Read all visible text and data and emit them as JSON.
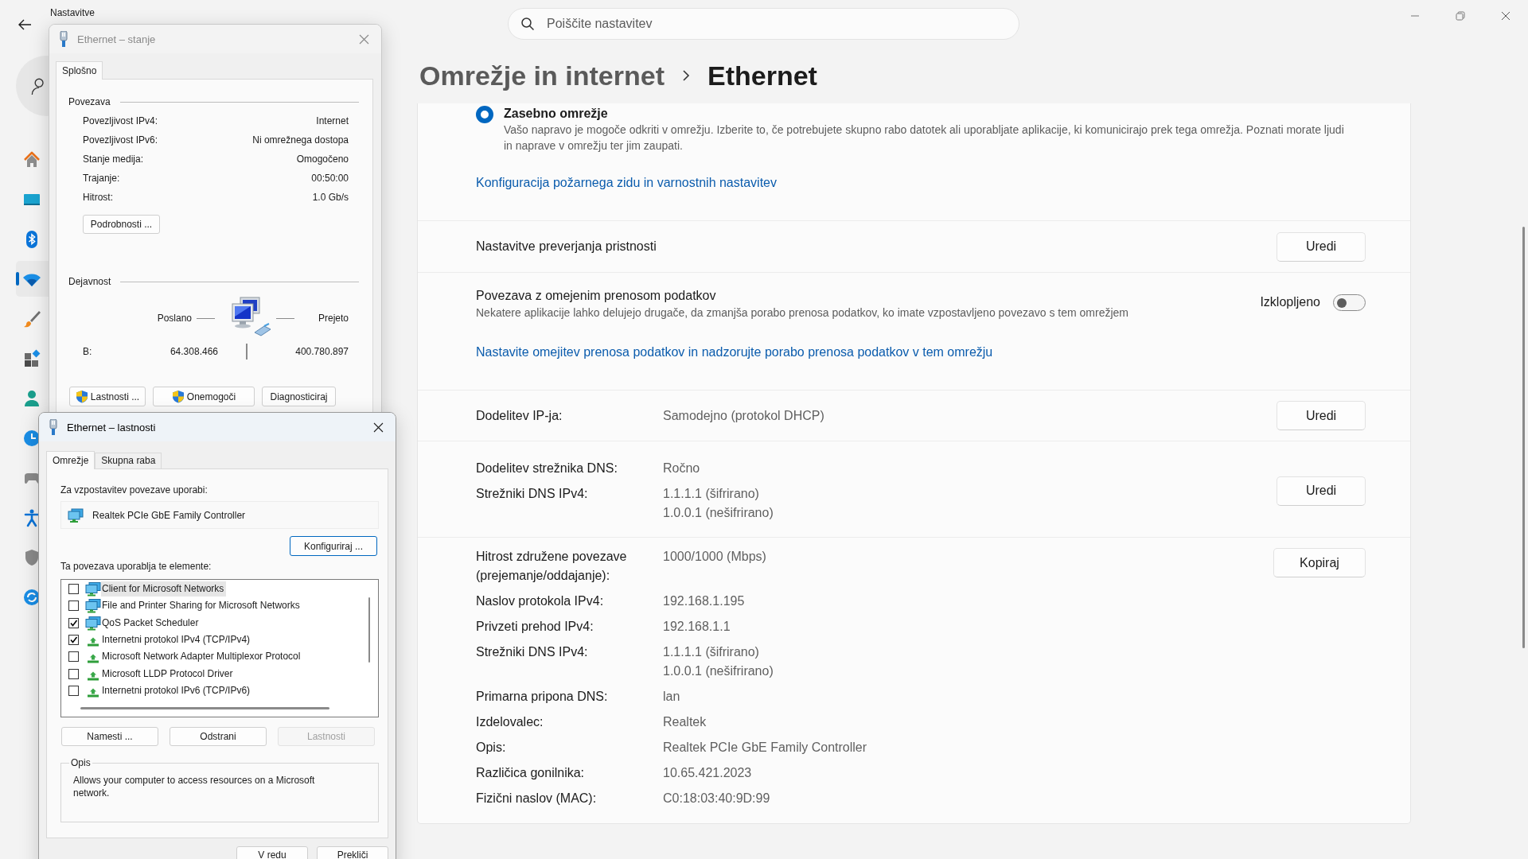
{
  "window": {
    "title": "Nastavitve"
  },
  "search": {
    "placeholder": "Poiščite nastavitev"
  },
  "sidebar": {
    "items": [
      {
        "kind": "home",
        "selected": false
      },
      {
        "kind": "system",
        "selected": false
      },
      {
        "kind": "bluetooth",
        "selected": false
      },
      {
        "kind": "network",
        "selected": true
      },
      {
        "kind": "personalization",
        "selected": false
      },
      {
        "kind": "apps",
        "selected": false
      },
      {
        "kind": "accounts",
        "selected": false
      },
      {
        "kind": "time",
        "selected": false
      },
      {
        "kind": "gaming",
        "selected": false
      },
      {
        "kind": "accessibility",
        "selected": false
      },
      {
        "kind": "privacy",
        "selected": false
      },
      {
        "kind": "update",
        "selected": false
      }
    ]
  },
  "breadcrumb": [
    "Omrežje in internet",
    "Ethernet"
  ],
  "sections": [
    {
      "kind": "profile",
      "option": {
        "label": "Zasebno omrežje",
        "description": "Vašo napravo je mogoče odkriti v omrežju. Izberite to, če potrebujete skupno rabo datotek ali uporabljate aplikacije, ki komunicirajo prek tega omrežja. Poznati morate ljudi in naprave v omrežju ter jim zaupati.",
        "selected": true
      },
      "link": "Konfiguracija požarnega zidu in varnostnih nastavitev"
    },
    {
      "kind": "setting",
      "label": "Nastavitve preverjanja pristnosti",
      "button": "Uredi"
    },
    {
      "kind": "metered",
      "label": "Povezava z omejenim prenosom podatkov",
      "description": "Nekatere aplikacije lahko delujejo drugače, da zmanjša porabo prenosa podatkov, ko imate vzpostavljeno povezavo s tem omrežjem",
      "state_label": "Izklopljeno",
      "on": false,
      "link": "Nastavite omejitev prenosa podatkov in nadzorujte porabo prenosa podatkov v tem omrežju"
    },
    {
      "kind": "properties",
      "rows": [
        {
          "label": "Dodelitev IP-ja:",
          "values": [
            "Samodejno (protokol DHCP)"
          ]
        }
      ],
      "button": "Uredi"
    },
    {
      "kind": "properties",
      "rows": [
        {
          "label": "Dodelitev strežnika DNS:",
          "values": [
            "Ročno"
          ]
        },
        {
          "label": "Strežniki DNS IPv4:",
          "values": [
            "1.1.1.1 (šifrirano)",
            "1.0.0.1 (nešifrirano)"
          ]
        }
      ],
      "button": "Uredi"
    },
    {
      "kind": "properties",
      "rows": [
        {
          "label": "Hitrost združene povezave (prejemanje/oddajanje):",
          "values": [
            "1000/1000 (Mbps)"
          ]
        },
        {
          "label": "Naslov protokola IPv4:",
          "values": [
            "192.168.1.195"
          ]
        },
        {
          "label": "Privzeti prehod IPv4:",
          "values": [
            "192.168.1.1"
          ]
        },
        {
          "label": "Strežniki DNS IPv4:",
          "values": [
            "1.1.1.1 (šifrirano)",
            "1.0.0.1 (nešifrirano)"
          ]
        },
        {
          "label": "Primarna pripona DNS:",
          "values": [
            "lan"
          ]
        },
        {
          "label": "Izdelovalec:",
          "values": [
            "Realtek"
          ]
        },
        {
          "label": "Opis:",
          "values": [
            "Realtek PCIe GbE Family Controller"
          ]
        },
        {
          "label": "Različica gonilnika:",
          "values": [
            "10.65.421.2023"
          ]
        },
        {
          "label": "Fizični naslov (MAC):",
          "values": [
            "C0:18:03:40:9D:99"
          ]
        }
      ],
      "button": "Kopiraj"
    }
  ],
  "status_dialog": {
    "title": "Ethernet – stanje",
    "active": false,
    "tabs": [
      {
        "label": "Splošno",
        "selected": true
      }
    ],
    "connection": {
      "heading": "Povezava",
      "rows": [
        {
          "label": "Povezljivost IPv4:",
          "value": "Internet"
        },
        {
          "label": "Povezljivost IPv6:",
          "value": "Ni omrežnega dostopa"
        },
        {
          "label": "Stanje medija:",
          "value": "Omogočeno"
        },
        {
          "label": "Trajanje:",
          "value": "00:50:00"
        },
        {
          "label": "Hitrost:",
          "value": "1.0 Gb/s"
        }
      ],
      "button": "Podrobnosti ..."
    },
    "activity": {
      "heading": "Dejavnost",
      "sent_label": "Poslano",
      "received_label": "Prejeto",
      "bytes_label": "B:",
      "sent": "64.308.466",
      "received": "400.780.897"
    },
    "buttons": [
      {
        "label": "Lastnosti ...",
        "shield": true
      },
      {
        "label": "Onemogoči",
        "shield": true
      },
      {
        "label": "Diagnosticiraj",
        "shield": false
      }
    ]
  },
  "properties_dialog": {
    "title": "Ethernet – lastnosti",
    "active": true,
    "tabs": [
      {
        "label": "Omrežje",
        "selected": true
      },
      {
        "label": "Skupna raba",
        "selected": false
      }
    ],
    "connect_using_label": "Za vzpostavitev povezave uporabi:",
    "adapter": "Realtek PCIe GbE Family Controller",
    "configure_button": "Konfiguriraj ...",
    "items_label": "Ta povezava uporablja te elemente:",
    "items": [
      {
        "label": "Client for Microsoft Networks",
        "kind": "service",
        "checked": false,
        "selected": true
      },
      {
        "label": "File and Printer Sharing for Microsoft Networks",
        "kind": "service",
        "checked": false,
        "selected": false
      },
      {
        "label": "QoS Packet Scheduler",
        "kind": "service",
        "checked": true,
        "selected": false
      },
      {
        "label": "Internetni protokol IPv4 (TCP/IPv4)",
        "kind": "protocol",
        "checked": true,
        "selected": false
      },
      {
        "label": "Microsoft Network Adapter Multiplexor Protocol",
        "kind": "protocol",
        "checked": false,
        "selected": false
      },
      {
        "label": "Microsoft LLDP Protocol Driver",
        "kind": "protocol",
        "checked": false,
        "selected": false
      },
      {
        "label": "Internetni protokol IPv6 (TCP/IPv6)",
        "kind": "protocol",
        "checked": false,
        "selected": false
      }
    ],
    "buttons": [
      {
        "label": "Namesti ...",
        "disabled": false
      },
      {
        "label": "Odstrani",
        "disabled": false
      },
      {
        "label": "Lastnosti",
        "disabled": true
      }
    ],
    "description": {
      "heading": "Opis",
      "text": "Allows your computer to access resources on a Microsoft network."
    },
    "footer_buttons": [
      "V redu",
      "Prekliči"
    ]
  }
}
